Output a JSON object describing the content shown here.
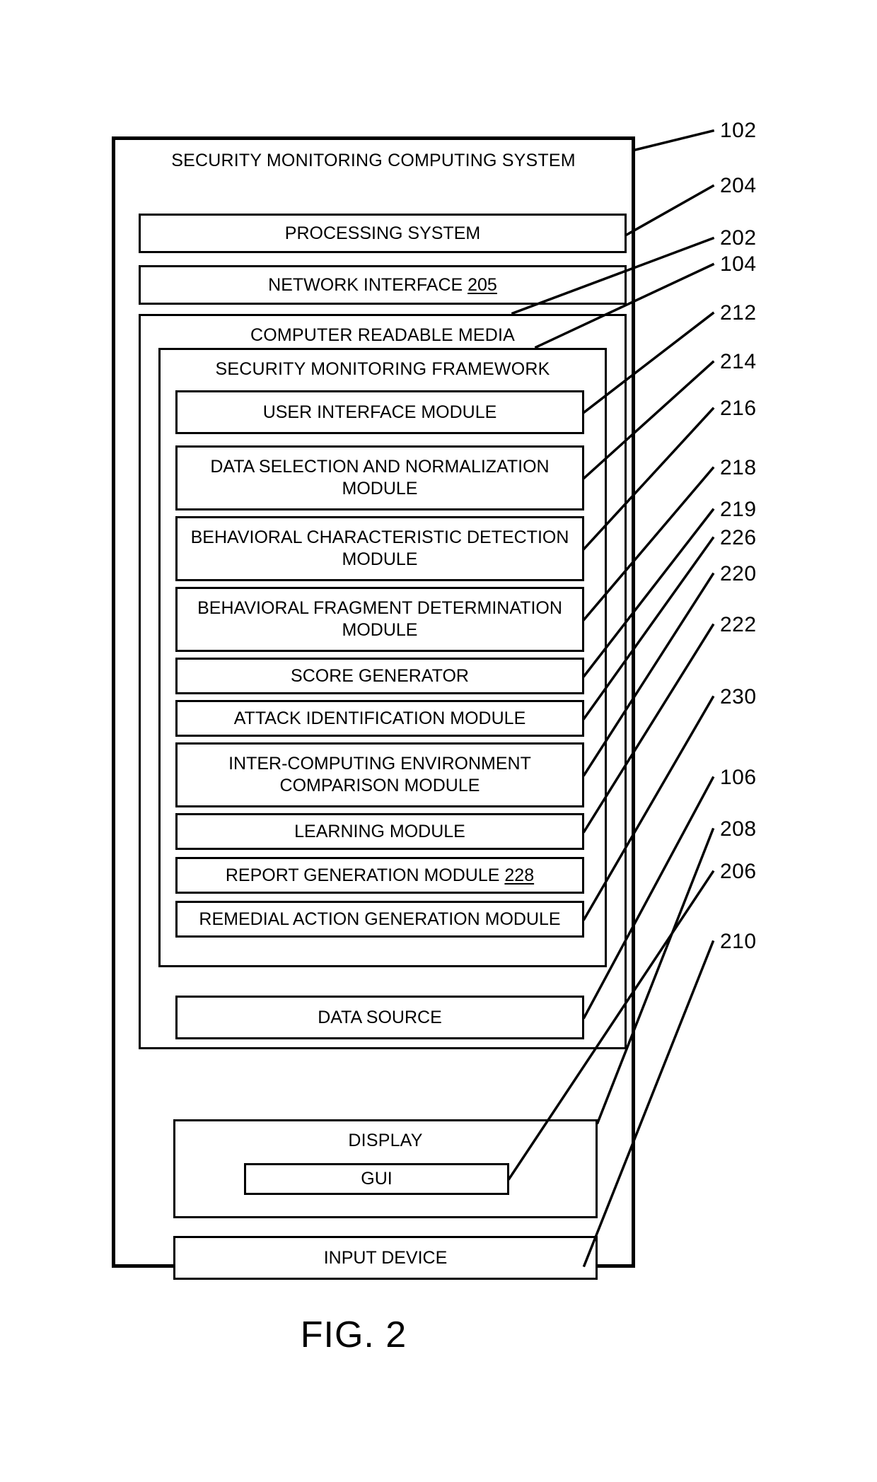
{
  "figure": {
    "caption": "FIG. 2"
  },
  "system": {
    "title": "SECURITY MONITORING COMPUTING SYSTEM",
    "ref": "102"
  },
  "processing_system": {
    "label": "PROCESSING SYSTEM",
    "ref": "204"
  },
  "network_interface": {
    "label": "NETWORK INTERFACE",
    "inline_ref": "205"
  },
  "computer_readable_media": {
    "title": "COMPUTER READABLE MEDIA",
    "ref": "202"
  },
  "security_monitoring_framework": {
    "title": "SECURITY MONITORING FRAMEWORK",
    "ref": "104",
    "modules": [
      {
        "label": "USER INTERFACE MODULE",
        "ref": "212"
      },
      {
        "label": "DATA SELECTION AND NORMALIZATION MODULE",
        "ref": "214"
      },
      {
        "label": "BEHAVIORAL CHARACTERISTIC DETECTION MODULE",
        "ref": "216"
      },
      {
        "label": "BEHAVIORAL FRAGMENT DETERMINATION MODULE",
        "ref": "218"
      },
      {
        "label": "SCORE GENERATOR",
        "ref": "219"
      },
      {
        "label": "ATTACK IDENTIFICATION MODULE",
        "ref": "226"
      },
      {
        "label": "INTER-COMPUTING ENVIRONMENT COMPARISON MODULE",
        "ref": "220"
      },
      {
        "label": "LEARNING MODULE",
        "ref": "222"
      },
      {
        "label": "REPORT GENERATION MODULE",
        "inline_ref": "228"
      },
      {
        "label": "REMEDIAL ACTION GENERATION MODULE",
        "ref": "230"
      }
    ]
  },
  "data_source": {
    "label": "DATA SOURCE",
    "ref": "106"
  },
  "display": {
    "title": "DISPLAY",
    "ref": "208",
    "gui": {
      "label": "GUI",
      "ref": "206"
    }
  },
  "input_device": {
    "label": "INPUT DEVICE",
    "ref": "210"
  },
  "colors": {
    "stroke": "#000000",
    "background": "#ffffff"
  }
}
